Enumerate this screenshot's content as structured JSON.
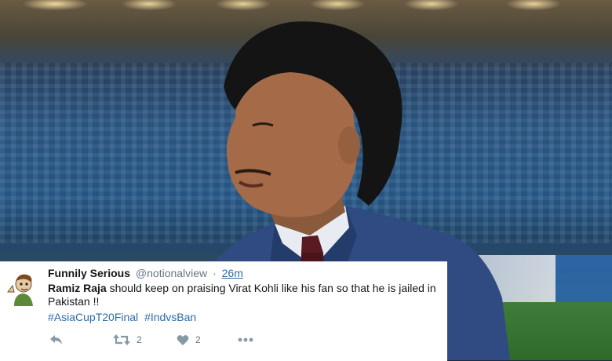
{
  "tweet": {
    "display_name": "Funnily Serious",
    "handle": "@notionalview",
    "separator": "·",
    "time": "26m",
    "mention": "Ramiz Raja",
    "text": " should keep on praising Virat Kohli like his fan so that he is jailed in Pakistan !!",
    "hashtags": [
      "#AsiaCupT20Final",
      "#IndvsBan"
    ],
    "retweet_count": "2",
    "like_count": "2"
  },
  "icons": {
    "reply": "reply-icon",
    "retweet": "retweet-icon",
    "like": "heart-icon",
    "more": "more-dots-icon"
  },
  "colors": {
    "link": "#2f6ba8",
    "muted": "#657786",
    "text": "#14171a"
  }
}
